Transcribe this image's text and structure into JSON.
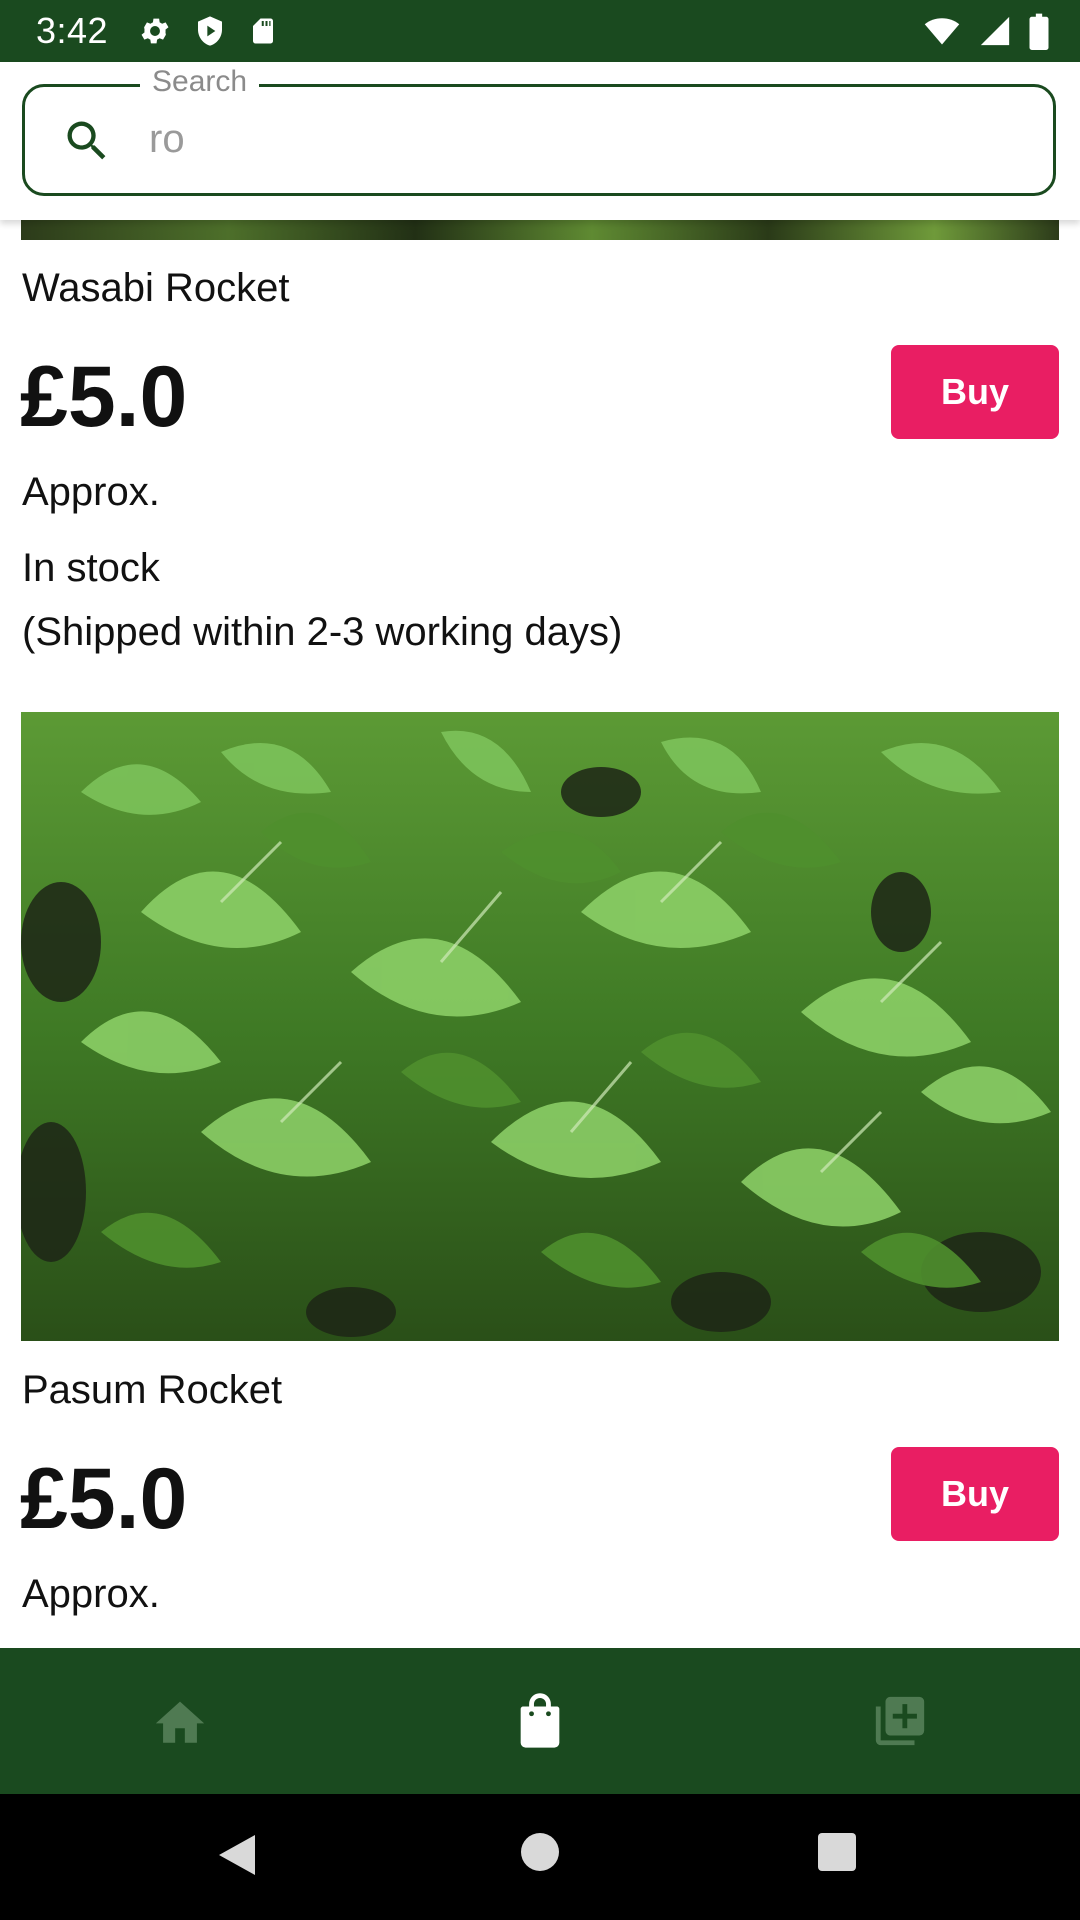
{
  "status_bar": {
    "time": "3:42",
    "left_icons": [
      "gear-icon",
      "shield-play-icon",
      "sd-card-icon"
    ],
    "right_icons": [
      "wifi-icon",
      "signal-icon",
      "battery-icon"
    ]
  },
  "search": {
    "label": "Search",
    "value": "ro"
  },
  "products": [
    {
      "name": "Wasabi Rocket",
      "price": "£5.0",
      "buy_label": "Buy",
      "approx": "Approx.",
      "stock": "In stock",
      "shipping": "(Shipped within 2-3 working days)"
    },
    {
      "name": "Pasum Rocket",
      "price": "£5.0",
      "buy_label": "Buy",
      "approx": "Approx."
    }
  ],
  "bottom_nav": {
    "items": [
      "home-icon",
      "shopping-bag-icon",
      "add-to-collection-icon"
    ],
    "active": "shopping-bag-icon"
  },
  "system_nav": [
    "back-icon",
    "home-circle-icon",
    "recents-icon"
  ],
  "colors": {
    "primary": "#1a4a1f",
    "accent": "#e91e63",
    "nav_inactive": "#4f7a52"
  }
}
